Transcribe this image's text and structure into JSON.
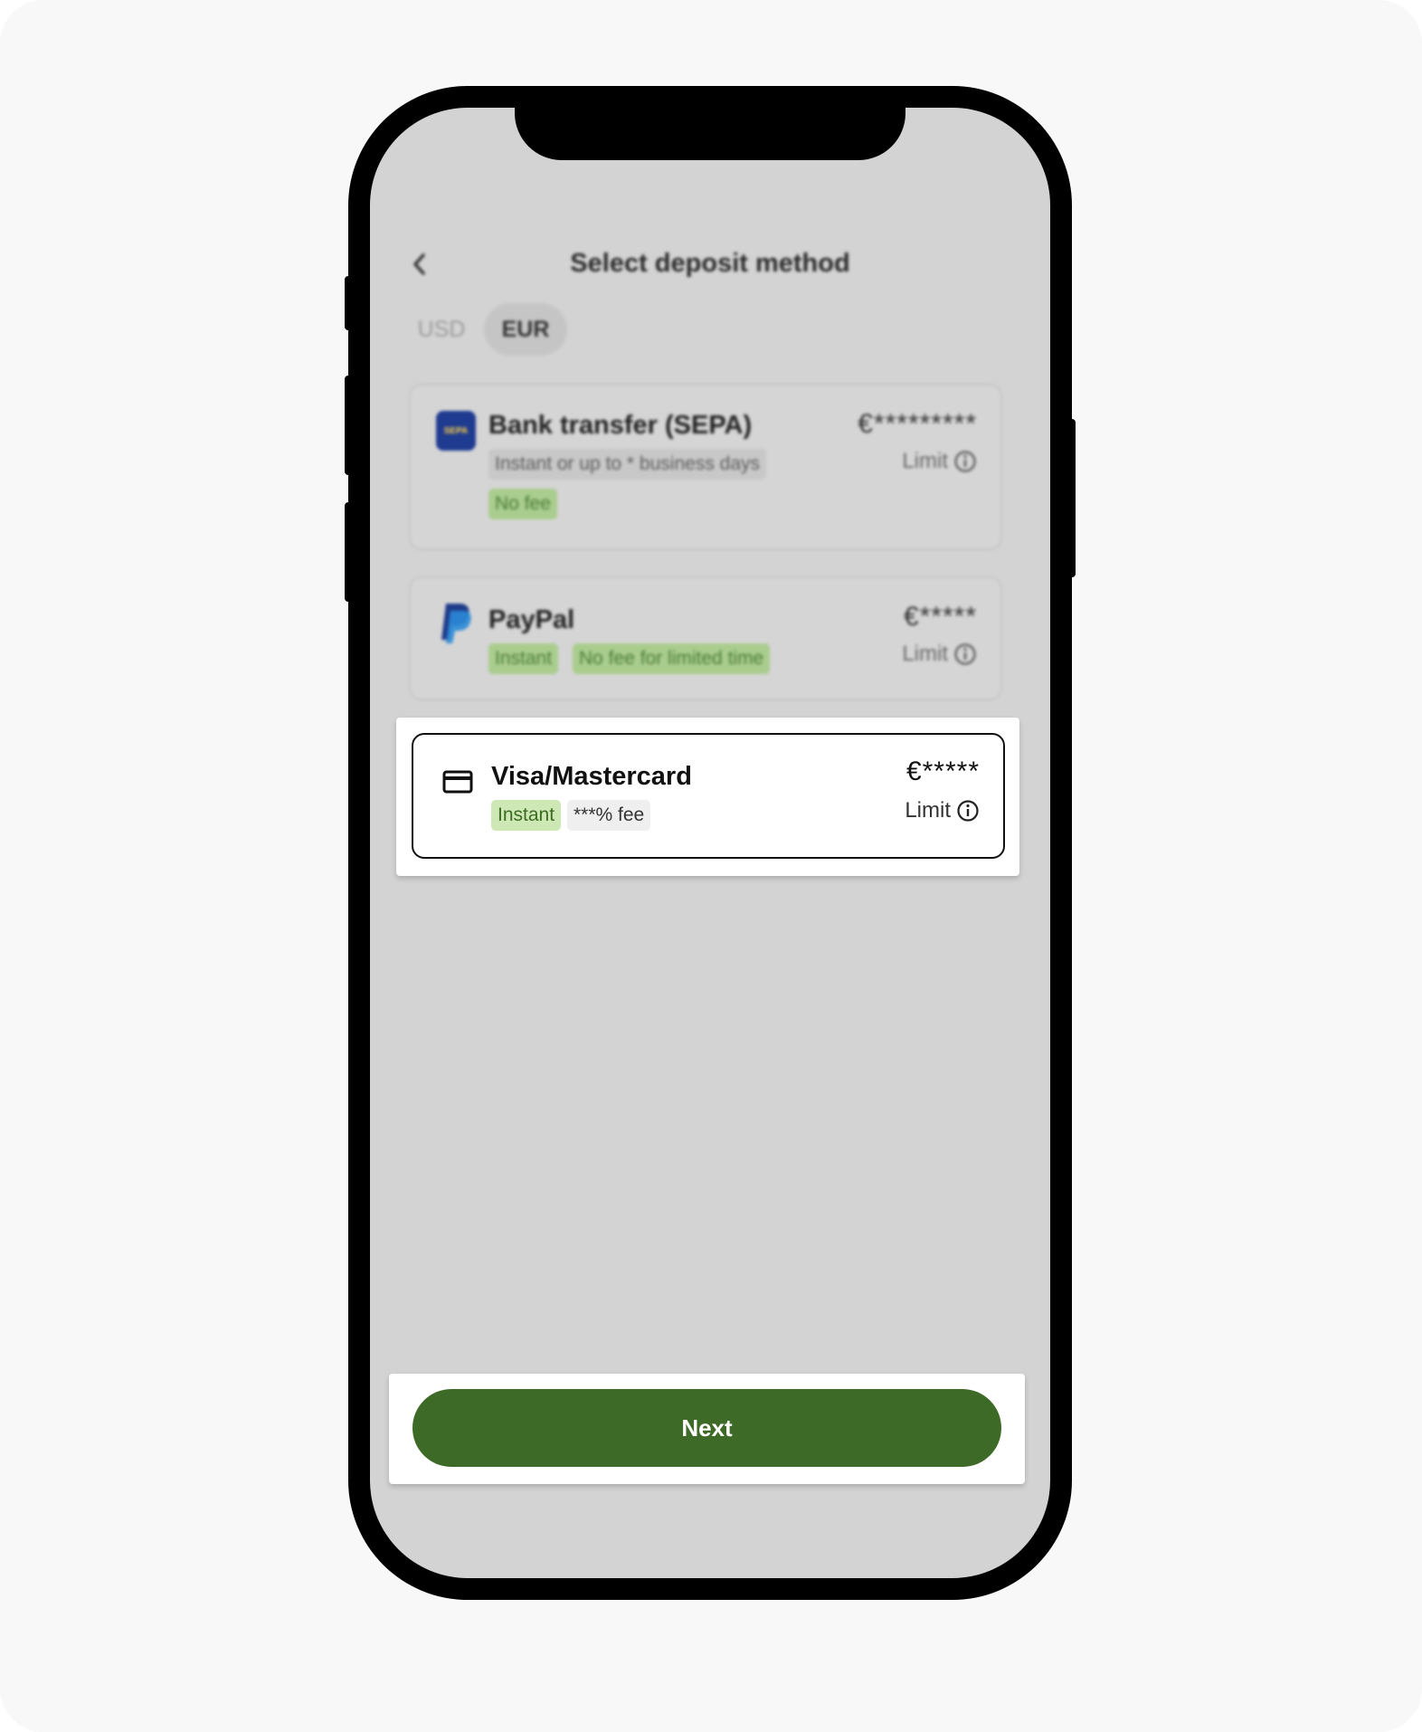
{
  "header": {
    "title": "Select deposit method",
    "back_icon": "chevron-left-icon"
  },
  "tabs": [
    {
      "label": "USD",
      "selected": false
    },
    {
      "label": "EUR",
      "selected": true
    }
  ],
  "methods": [
    {
      "name": "Bank transfer (SEPA)",
      "icon": "sepa-logo",
      "logo_text": "SEPA",
      "tags": [
        "Instant or up to * business days",
        "No fee"
      ],
      "amount": "€*********",
      "limit_label": "Limit"
    },
    {
      "name": "PayPal",
      "icon": "paypal-logo",
      "tags": [
        "Instant",
        "No fee for limited time"
      ],
      "amount": "€*****",
      "limit_label": "Limit"
    },
    {
      "name": "Visa/Mastercard",
      "icon": "credit-card-icon",
      "tags": [
        "Instant",
        "***% fee"
      ],
      "amount": "€*****",
      "limit_label": "Limit",
      "selected": true
    }
  ],
  "next_label": "Next",
  "colors": {
    "primary": "#3d6a26",
    "green_chip": "#cde8b4",
    "screen_dim": "#d3d3d3"
  }
}
